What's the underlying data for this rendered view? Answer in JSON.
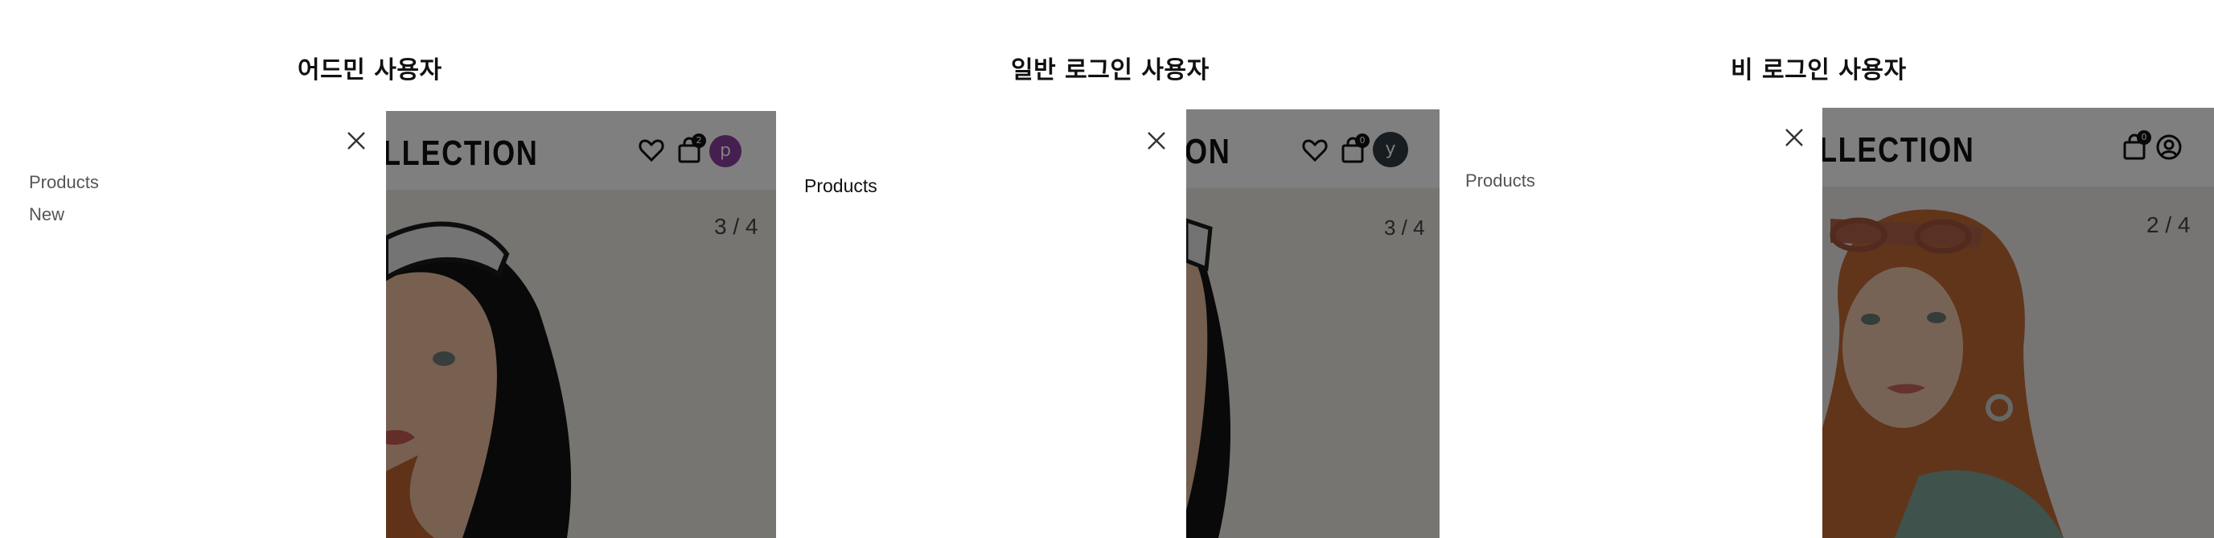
{
  "panels": [
    {
      "title": "어드민 사용자",
      "menu": [
        "Products",
        "New"
      ],
      "brand": "LLECTION",
      "cart_count": "2",
      "avatar_letter": "p",
      "avatar_color": "#8b3ea1",
      "slide_counter": "3 / 4"
    },
    {
      "title": "일반 로그인 사용자",
      "menu": [
        "Products"
      ],
      "brand": "ON",
      "cart_count": "0",
      "avatar_letter": "y",
      "avatar_color": "#2f3a40",
      "slide_counter": "3 / 4"
    },
    {
      "title": "비 로그인 사용자",
      "menu": [
        "Products"
      ],
      "brand": "LLECTION",
      "cart_count": "0",
      "slide_counter": "2 / 4"
    }
  ],
  "icons": [
    "close-icon",
    "heart-icon",
    "shopping-bag-icon",
    "user-circle-icon"
  ],
  "colors": {
    "overlay": "rgba(0,0,0,0.5)",
    "title": "#111111",
    "menu_text": "#555555"
  }
}
